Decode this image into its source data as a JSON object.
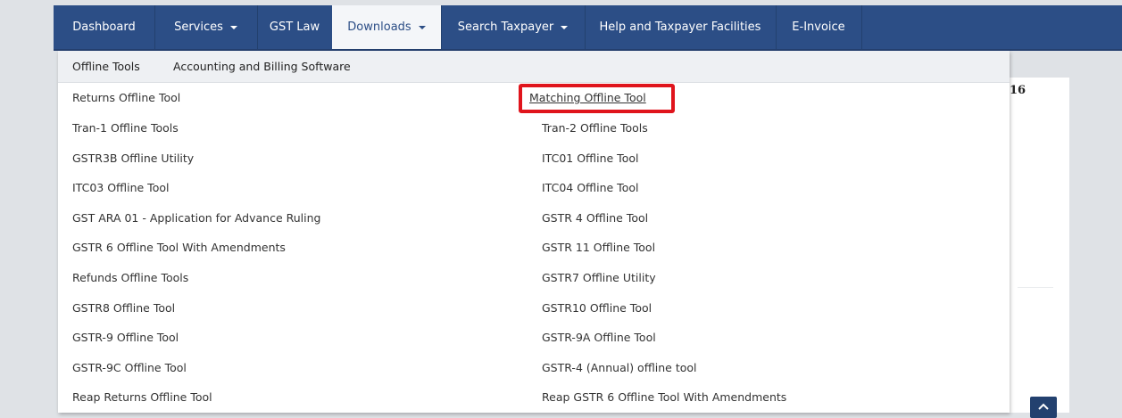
{
  "navbar": {
    "items": [
      {
        "label": "Dashboard",
        "dropdown": false
      },
      {
        "label": "Services",
        "dropdown": true
      },
      {
        "label": "GST Law",
        "dropdown": false
      },
      {
        "label": "Downloads",
        "dropdown": true,
        "active": true
      },
      {
        "label": "Search Taxpayer",
        "dropdown": true
      },
      {
        "label": "Help and Taxpayer Facilities",
        "dropdown": false
      },
      {
        "label": "E-Invoice",
        "dropdown": false
      }
    ]
  },
  "downloads_menu": {
    "subtabs": [
      "Offline Tools",
      "Accounting and Billing Software"
    ],
    "left_column": [
      "Returns Offline Tool",
      "Tran-1 Offline Tools",
      "GSTR3B Offline Utility",
      "ITC03 Offline Tool",
      "GST ARA 01 - Application for Advance Ruling",
      "GSTR 6 Offline Tool With Amendments",
      "Refunds Offline Tools",
      "GSTR8 Offline Tool",
      "GSTR-9 Offline Tool",
      "GSTR-9C Offline Tool",
      "Reap Returns Offline Tool"
    ],
    "right_column": [
      "Matching Offline Tool",
      "Tran-2 Offline Tools",
      "ITC01 Offline Tool",
      "ITC04 Offline Tool",
      "GSTR 4 Offline Tool",
      "GSTR 11 Offline Tool",
      "GSTR7 Offline Utility",
      "GSTR10 Offline Tool",
      "GSTR-9A Offline Tool",
      "GSTR-4 (Annual) offline tool",
      "Reap GSTR 6 Offline Tool With Amendments"
    ],
    "highlighted": "Matching Offline Tool",
    "highlight_color": "#e0141c"
  },
  "background": {
    "card_text": "16"
  },
  "colors": {
    "navbar": "#2c4e86",
    "page_bg": "#dfe2e6"
  },
  "icons": {
    "scroll_top": "chevron-up-icon"
  }
}
